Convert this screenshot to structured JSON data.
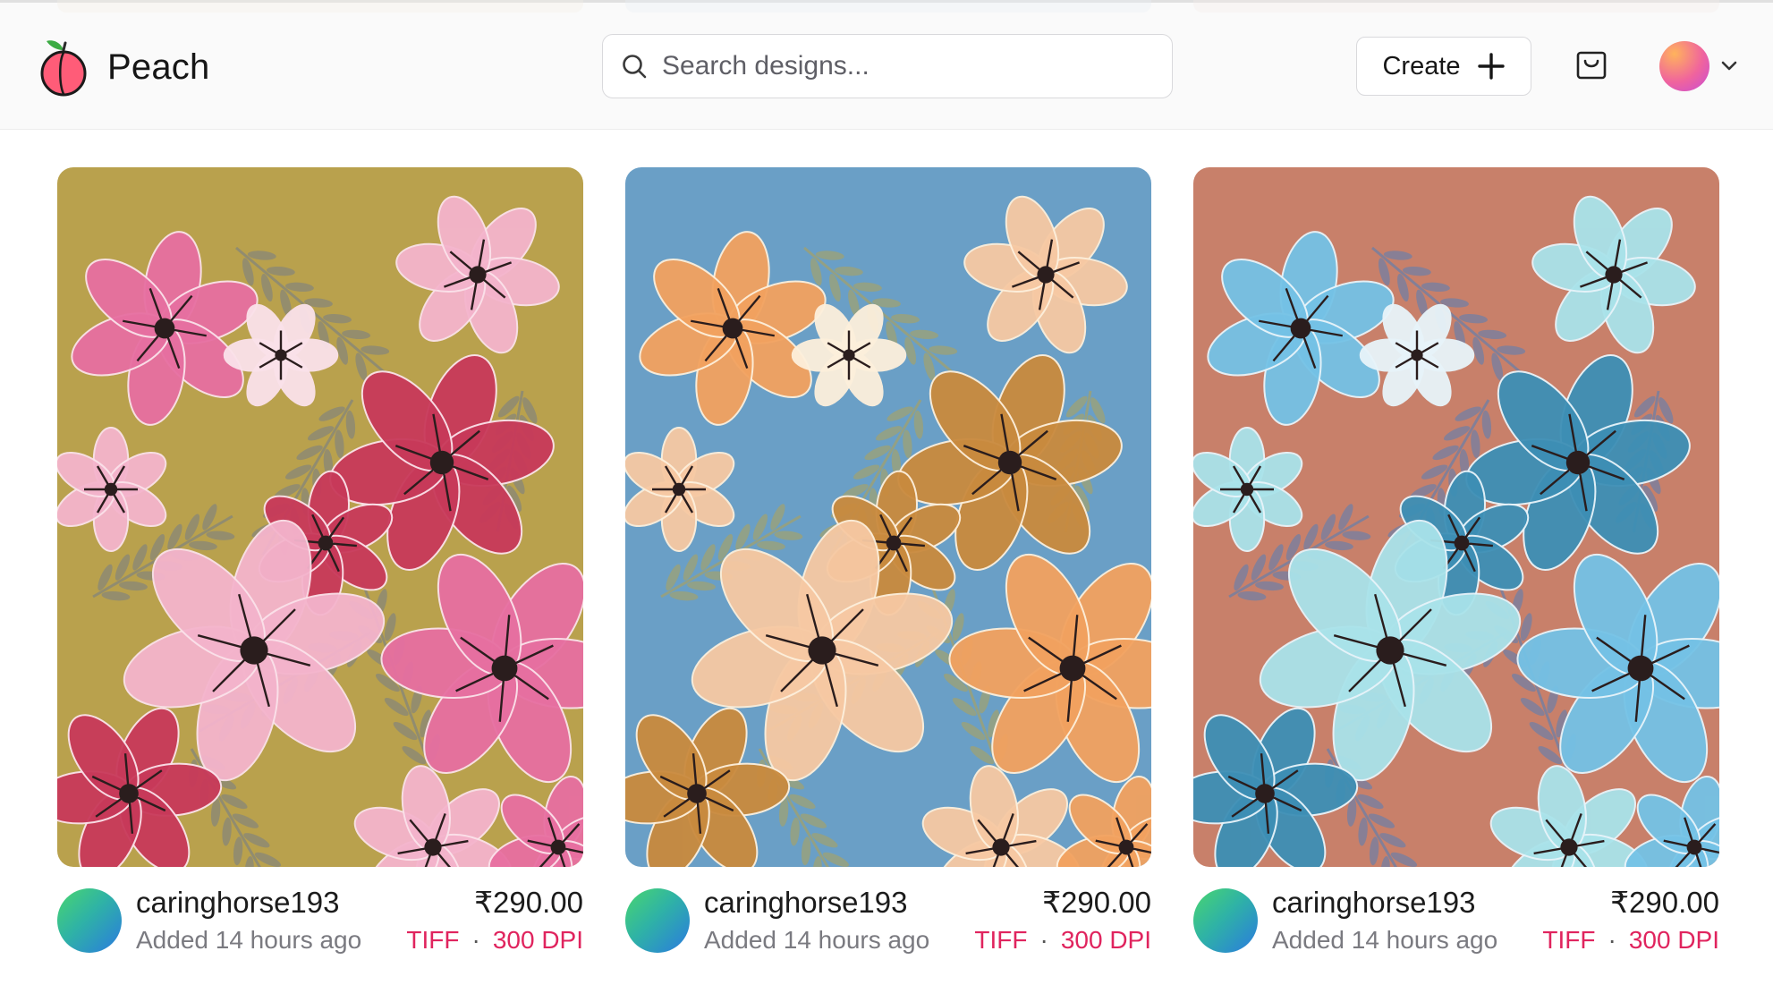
{
  "app": {
    "name": "Peach"
  },
  "search": {
    "placeholder": "Search designs..."
  },
  "header": {
    "create_label": "Create"
  },
  "colors": {
    "accent": "#e0245e",
    "background": "#ffffff"
  },
  "designs": [
    {
      "seller": "caringhorse193",
      "added": "Added 14 hours ago",
      "price": "₹290.00",
      "format": "TIFF",
      "resolution": "300 DPI",
      "palette": {
        "bg": "#b9a14d",
        "flower1": "#e76fa1",
        "flower2": "#c8395a",
        "flower3": "#f4b4cc",
        "leaf": "#8d8a73",
        "light": "#fbe2ea"
      }
    },
    {
      "seller": "caringhorse193",
      "added": "Added 14 hours ago",
      "price": "₹290.00",
      "format": "TIFF",
      "resolution": "300 DPI",
      "palette": {
        "bg": "#6a9fc6",
        "flower1": "#f2a25f",
        "flower2": "#c98a3e",
        "flower3": "#f7c9a3",
        "leaf": "#98a17d",
        "light": "#fdf0dc"
      }
    },
    {
      "seller": "caringhorse193",
      "added": "Added 14 hours ago",
      "price": "₹290.00",
      "format": "TIFF",
      "resolution": "300 DPI",
      "palette": {
        "bg": "#c8806a",
        "flower1": "#74c2e6",
        "flower2": "#3d8fb5",
        "flower3": "#a9e3ea",
        "leaf": "#7c7f9c",
        "light": "#e8f4fa"
      }
    }
  ]
}
